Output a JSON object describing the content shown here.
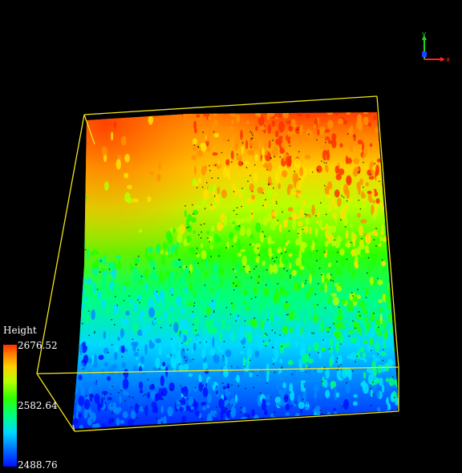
{
  "viewer": {
    "background": "#000000",
    "bounding_box_color": "#f2e31c"
  },
  "legend": {
    "title": "Height",
    "max_label": "2676.52",
    "mid_label": "2582.64",
    "min_label": "2488.76",
    "colormap": [
      "#0010ff",
      "#0088ff",
      "#00e0ff",
      "#00ff7a",
      "#22ff00",
      "#b8ff00",
      "#ffe000",
      "#ff9000",
      "#ff3000"
    ]
  },
  "axes": {
    "x_label": "x",
    "y_label": "y",
    "x_color": "#ff2020",
    "y_color": "#1fd01f",
    "z_color": "#2040ff"
  }
}
